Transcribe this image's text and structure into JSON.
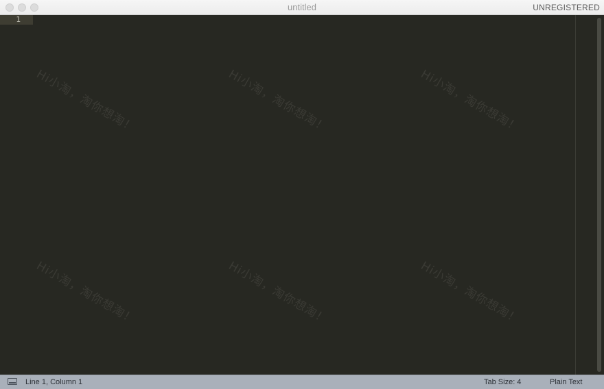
{
  "window": {
    "title": "untitled",
    "registration_status": "UNREGISTERED"
  },
  "editor": {
    "line_numbers": [
      "1"
    ],
    "watermark_text": "Hi小淘，淘你想淘！"
  },
  "statusbar": {
    "position": "Line 1, Column 1",
    "tab_size": "Tab Size: 4",
    "syntax": "Plain Text",
    "panel_icon": "panel-toggle-icon"
  },
  "colors": {
    "editor_background": "#272822",
    "statusbar_background": "#a9b0ba",
    "titlebar_background": "#ececec"
  }
}
